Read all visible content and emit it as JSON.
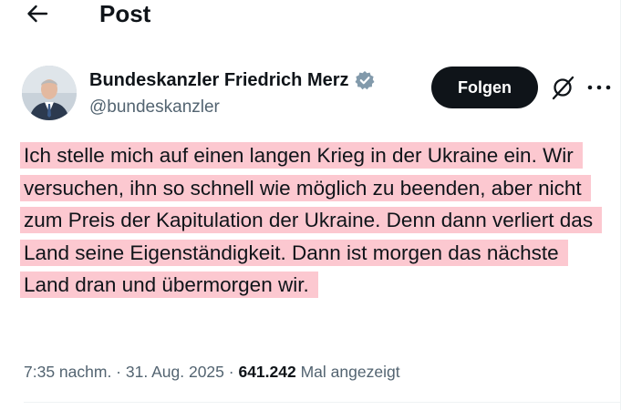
{
  "header": {
    "title": "Post",
    "back_icon": "arrow-left-icon"
  },
  "author": {
    "display_name": "Bundeskanzler Friedrich Merz",
    "handle": "@bundeskanzler",
    "verified_icon": "verified-badge-icon",
    "verified_color": "#829aab"
  },
  "actions": {
    "follow_label": "Folgen",
    "grok_icon": "grok-icon",
    "more_icon": "more-options-icon"
  },
  "tweet": {
    "text": "Ich stelle mich auf einen langen Krieg in der Ukraine ein. Wir versuchen, ihn so schnell wie möglich zu beenden, aber nicht zum Preis der Kapitulation der Ukraine. Denn dann verliert das Land seine Eigenständigkeit. Dann ist morgen das nächste Land dran und übermorgen wir.",
    "highlight_color": "#fcc8d0"
  },
  "meta": {
    "time": "7:35 nachm.",
    "separator": " · ",
    "date": "31. Aug. 2025",
    "views_count": "641.242",
    "views_label": "Mal angezeigt"
  },
  "colors": {
    "text_primary": "#0f1419",
    "text_secondary": "#536471",
    "button_bg": "#0f1419"
  }
}
